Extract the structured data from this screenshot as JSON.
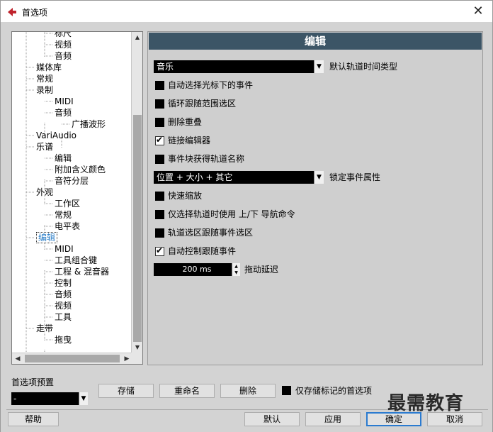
{
  "window": {
    "title": "首选项",
    "close_glyph": "✕"
  },
  "tree": {
    "items": [
      {
        "label": "标尺",
        "level": 2
      },
      {
        "label": "视频",
        "level": 2
      },
      {
        "label": "音频",
        "level": 2
      },
      {
        "label": "媒体库",
        "level": 1
      },
      {
        "label": "常规",
        "level": 1
      },
      {
        "label": "录制",
        "level": 1
      },
      {
        "label": "MIDI",
        "level": 2
      },
      {
        "label": "音频",
        "level": 2
      },
      {
        "label": "广播波形",
        "level": 3
      },
      {
        "label": "VariAudio",
        "level": 1
      },
      {
        "label": "乐谱",
        "level": 1
      },
      {
        "label": "编辑",
        "level": 2
      },
      {
        "label": "附加含义颜色",
        "level": 2
      },
      {
        "label": "音符分层",
        "level": 2
      },
      {
        "label": "外观",
        "level": 1
      },
      {
        "label": "工作区",
        "level": 2
      },
      {
        "label": "常规",
        "level": 2
      },
      {
        "label": "电平表",
        "level": 2
      },
      {
        "label": "编辑",
        "level": 1,
        "selected": true
      },
      {
        "label": "MIDI",
        "level": 2
      },
      {
        "label": "工具组合键",
        "level": 2
      },
      {
        "label": "工程 & 混音器",
        "level": 2
      },
      {
        "label": "控制",
        "level": 2
      },
      {
        "label": "音频",
        "level": 2
      },
      {
        "label": "视频",
        "level": 2
      },
      {
        "label": "工具",
        "level": 2
      },
      {
        "label": "走带",
        "level": 1
      },
      {
        "label": "拖曳",
        "level": 2
      }
    ]
  },
  "panel": {
    "header": "编辑",
    "track_type_select": {
      "value": "音乐",
      "label": "默认轨道时间类型"
    },
    "options_a": [
      {
        "label": "自动选择光标下的事件",
        "checked": false
      },
      {
        "label": "循环跟随范围选区",
        "checked": false
      },
      {
        "label": "删除重叠",
        "checked": false
      },
      {
        "label": "链接编辑器",
        "checked": true
      },
      {
        "label": "事件块获得轨道名称",
        "checked": false
      }
    ],
    "lock_select": {
      "value": "位置 + 大小 + 其它",
      "label": "锁定事件属性"
    },
    "options_b": [
      {
        "label": "快速缩放",
        "checked": false
      },
      {
        "label": "仅选择轨道时使用 上/下 导航命令",
        "checked": false
      },
      {
        "label": "轨道选区跟随事件选区",
        "checked": false
      },
      {
        "label": "自动控制跟随事件",
        "checked": true
      }
    ],
    "drag_delay": {
      "value": "200 ms",
      "label": "拖动延迟"
    }
  },
  "presets": {
    "label": "首选项预置",
    "select_value": "-",
    "store": "存储",
    "rename": "重命名",
    "delete": "删除",
    "only_marked_label": "仅存储标记的首选项",
    "only_marked_checked": false
  },
  "footer": {
    "help": "帮助",
    "defaults": "默认",
    "apply": "应用",
    "ok": "确定",
    "cancel": "取消"
  },
  "watermark": "最需教育",
  "colors": {
    "header_bg": "#3c5566",
    "selected_text": "#2d7fc8",
    "default_button_border": "#2b7bd0"
  }
}
